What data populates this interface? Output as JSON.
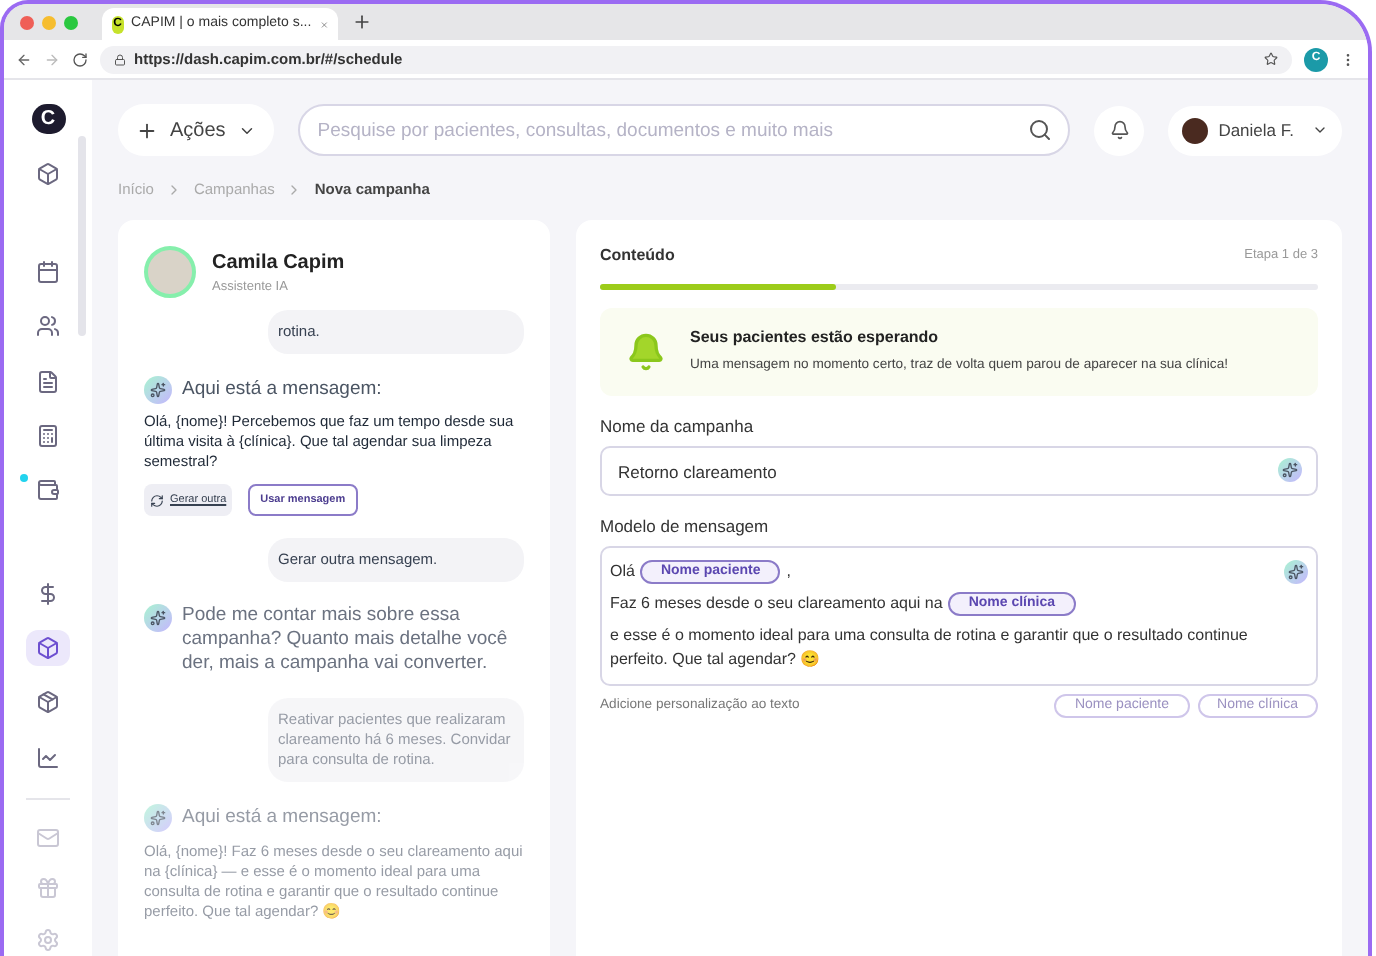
{
  "browser": {
    "tab_title": "CAPIM | o mais completo s...",
    "tab_logo": "C",
    "url": "https://dash.capim.com.br/#/schedule",
    "profile_initial": "C"
  },
  "sidebar": {
    "logo": "C",
    "items": [
      {
        "kind": "cube",
        "selected": false,
        "dot": false
      },
      {
        "kind": "calendar",
        "selected": false,
        "dot": false
      },
      {
        "kind": "users",
        "selected": false,
        "dot": false
      },
      {
        "kind": "document",
        "selected": false,
        "dot": false
      },
      {
        "kind": "calculator",
        "selected": false,
        "dot": false
      },
      {
        "kind": "wallet",
        "selected": false,
        "dot": true
      },
      {
        "kind": "dollar",
        "selected": false,
        "dot": false
      },
      {
        "kind": "cube",
        "selected": true,
        "dot": false
      },
      {
        "kind": "box",
        "selected": false,
        "dot": false
      },
      {
        "kind": "chart",
        "selected": false,
        "dot": false
      }
    ],
    "footer_items": [
      {
        "kind": "mail"
      },
      {
        "kind": "gift"
      },
      {
        "kind": "settings"
      }
    ]
  },
  "topbar": {
    "actions_label": "Ações",
    "search_placeholder": "Pesquise por pacientes, consultas, documentos e muito mais",
    "user_name": "Daniela F."
  },
  "breadcrumb": [
    {
      "label": "Início",
      "current": false
    },
    {
      "label": "Campanhas",
      "current": false
    },
    {
      "label": "Nova campanha",
      "current": true
    }
  ],
  "assistant": {
    "name": "Camila Capim",
    "role": "Assistente IA",
    "messages": [
      {
        "kind": "user",
        "text": "rotina.",
        "faded": false
      },
      {
        "kind": "suggestion",
        "title": "Aqui está a mensagem:",
        "text": "Olá, {nome}! Percebemos que faz um tempo desde sua última visita à {clínica}. Que tal agendar sua limpeza semestral?",
        "actions": [
          "Gerar outra",
          "Usar mensagem"
        ],
        "faded": false
      },
      {
        "kind": "user",
        "text": "Gerar outra mensagem.",
        "faded": false
      },
      {
        "kind": "ai",
        "text": "Pode me contar mais sobre essa campanha? Quanto mais detalhe você der, mais a campanha vai converter.",
        "faded": false
      },
      {
        "kind": "user",
        "text": "Reativar pacientes que realizaram clareamento há 6 meses. Convidar para consulta de rotina.",
        "faded": true
      },
      {
        "kind": "suggestion",
        "title": "Aqui está a mensagem:",
        "text": "Olá, {nome}! Faz 6 meses desde o seu clareamento aqui na {clínica} — e esse é o momento ideal para uma consulta de rotina e garantir que o resultado continue perfeito. Que tal agendar? 😊",
        "faded": true
      }
    ]
  },
  "content": {
    "tab": "Conteúdo",
    "step": "Etapa 1 de 3",
    "level": 0.33,
    "banner": {
      "title": "Seus pacientes estão esperando",
      "text": "Uma mensagem no momento certo, traz de volta quem parou de aparecer na sua clínica!"
    },
    "name_label": "Nome da campanha",
    "name_value": "Retorno clareamento",
    "template_label": "Modelo de mensagem",
    "template_lines": [
      [
        {
          "kind": "text",
          "text": "Olá"
        },
        {
          "kind": "tag",
          "text": "Nome paciente"
        },
        {
          "kind": "text",
          "text": ","
        }
      ],
      [
        {
          "kind": "text",
          "text": "Faz 6 meses desde o seu clareamento aqui na"
        },
        {
          "kind": "tag",
          "text": "Nome clínica"
        }
      ],
      [
        {
          "kind": "text",
          "text": "e esse é o momento ideal para uma consulta de rotina e garantir que o resultado continue perfeito. Que tal agendar? 😊"
        }
      ]
    ],
    "hint": "Adicione personalização ao texto",
    "chips": [
      "Nome paciente",
      "Nome clínica"
    ]
  }
}
